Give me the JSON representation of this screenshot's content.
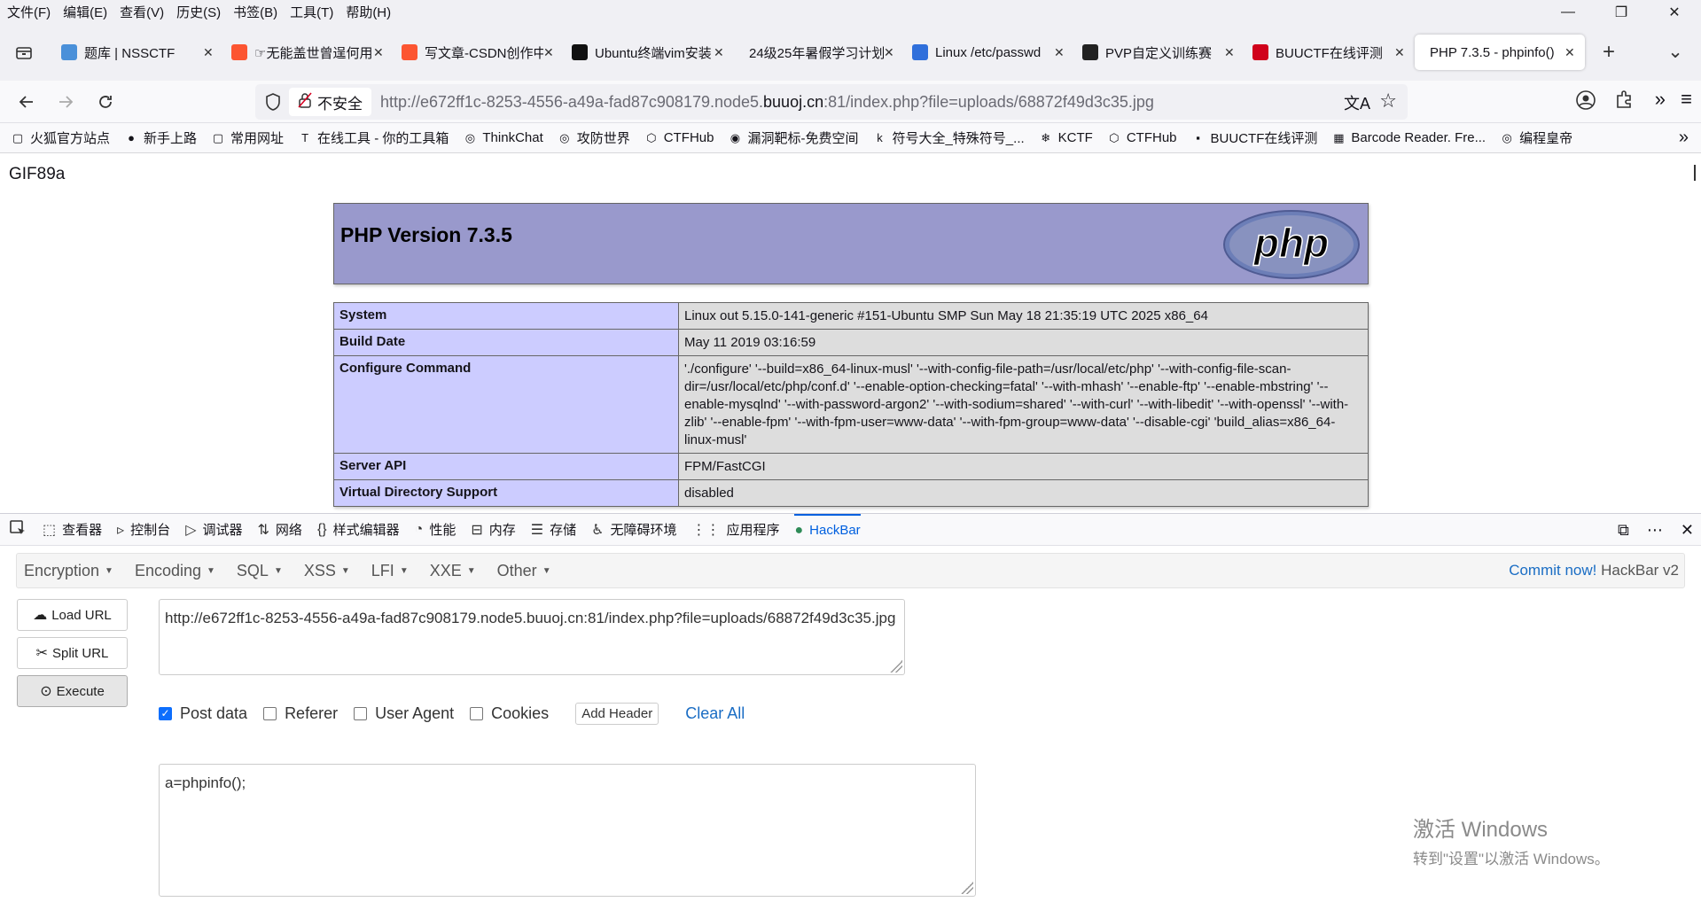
{
  "menubar": {
    "items": [
      "文件(F)",
      "编辑(E)",
      "查看(V)",
      "历史(S)",
      "书签(B)",
      "工具(T)",
      "帮助(H)"
    ]
  },
  "window": {
    "minimize": "—",
    "restore": "❐",
    "close": "✕"
  },
  "tabs": [
    {
      "label": "题库 | NSSCTF",
      "icon_color": "#4a90d9"
    },
    {
      "label": "☞无能盖世曾逞何用",
      "icon_color": "#fc5531"
    },
    {
      "label": "写文章-CSDN创作中心",
      "icon_color": "#fc5531"
    },
    {
      "label": "Ubuntu终端vim安装",
      "icon_color": "#111111"
    },
    {
      "label": "24级25年暑假学习计划",
      "icon_color": "#ffffff"
    },
    {
      "label": "Linux /etc/passwd",
      "icon_color": "#2f6fdb"
    },
    {
      "label": "PVP自定义训练赛",
      "icon_color": "#222222"
    },
    {
      "label": "BUUCTF在线评测",
      "icon_color": "#d0021b"
    },
    {
      "label": "PHP 7.3.5 - phpinfo()",
      "icon_color": "#ffffff",
      "active": true
    }
  ],
  "tab_close": "✕",
  "new_tab": "+",
  "tab_list": "⌄",
  "nav": {
    "insecure_label": "不安全",
    "url_prefix": "http://e672ff1c-8253-4556-a49a-fad87c908179.node5.",
    "url_domain": "buuoj.cn",
    "url_suffix": ":81/index.php?file=uploads/68872f49d3c35.jpg"
  },
  "bookmarks": [
    {
      "label": "火狐官方站点",
      "icon": "▢"
    },
    {
      "label": "新手上路",
      "icon": "●"
    },
    {
      "label": "常用网址",
      "icon": "▢"
    },
    {
      "label": "在线工具 - 你的工具箱",
      "icon": "T"
    },
    {
      "label": "ThinkChat",
      "icon": "◎"
    },
    {
      "label": "攻防世界",
      "icon": "◎"
    },
    {
      "label": "CTFHub",
      "icon": "⬡"
    },
    {
      "label": "漏洞靶标-免费空间",
      "icon": "◉"
    },
    {
      "label": "符号大全_特殊符号_...",
      "icon": "k"
    },
    {
      "label": "KCTF",
      "icon": "❄"
    },
    {
      "label": "CTFHub",
      "icon": "⬡"
    },
    {
      "label": "BUUCTF在线评测",
      "icon": "▪"
    },
    {
      "label": "Barcode Reader. Fre...",
      "icon": "▦"
    },
    {
      "label": "编程皇帝",
      "icon": "◎"
    }
  ],
  "page": {
    "gif_header": "GIF89a",
    "php_title": "PHP Version 7.3.5",
    "php_logo_text": "php",
    "rows": [
      {
        "key": "System",
        "value": "Linux out 5.15.0-141-generic #151-Ubuntu SMP Sun May 18 21:35:19 UTC 2025 x86_64"
      },
      {
        "key": "Build Date",
        "value": "May 11 2019 03:16:59"
      },
      {
        "key": "Configure Command",
        "value": "'./configure' '--build=x86_64-linux-musl' '--with-config-file-path=/usr/local/etc/php' '--with-config-file-scan-dir=/usr/local/etc/php/conf.d' '--enable-option-checking=fatal' '--with-mhash' '--enable-ftp' '--enable-mbstring' '--enable-mysqlnd' '--with-password-argon2' '--with-sodium=shared' '--with-curl' '--with-libedit' '--with-openssl' '--with-zlib' '--enable-fpm' '--with-fpm-user=www-data' '--with-fpm-group=www-data' '--disable-cgi' 'build_alias=x86_64-linux-musl'"
      },
      {
        "key": "Server API",
        "value": "FPM/FastCGI"
      },
      {
        "key": "Virtual Directory Support",
        "value": "disabled"
      }
    ]
  },
  "devtools": {
    "tabs": [
      {
        "label": "查看器",
        "icon": "⬚"
      },
      {
        "label": "控制台",
        "icon": "▹"
      },
      {
        "label": "调试器",
        "icon": "▷"
      },
      {
        "label": "网络",
        "icon": "⇅"
      },
      {
        "label": "样式编辑器",
        "icon": "{}"
      },
      {
        "label": "性能",
        "icon": "◔"
      },
      {
        "label": "内存",
        "icon": "⊟"
      },
      {
        "label": "存储",
        "icon": "☰"
      },
      {
        "label": "无障碍环境",
        "icon": "♿"
      },
      {
        "label": "应用程序",
        "icon": "⋮⋮"
      },
      {
        "label": "HackBar",
        "icon": "●",
        "active": true
      }
    ],
    "right": [
      "⧉",
      "⋯",
      "✕"
    ]
  },
  "hackbar": {
    "menus": [
      "Encryption",
      "Encoding",
      "SQL",
      "XSS",
      "LFI",
      "XXE",
      "Other"
    ],
    "commit_link": "Commit now!",
    "version": "HackBar v2",
    "load_url": "Load URL",
    "split_url": "Split URL",
    "execute": "Execute",
    "url_value": "http://e672ff1c-8253-4556-a49a-fad87c908179.node5.buuoj.cn:81/index.php?file=uploads/68872f49d3c35.jpg",
    "options": [
      {
        "label": "Post data",
        "checked": true
      },
      {
        "label": "Referer",
        "checked": false
      },
      {
        "label": "User Agent",
        "checked": false
      },
      {
        "label": "Cookies",
        "checked": false
      }
    ],
    "add_header": "Add Header",
    "clear_all": "Clear All",
    "post_value": "a=phpinfo();"
  },
  "watermark": {
    "line1": "激活 Windows",
    "line2": "转到\"设置\"以激活 Windows。"
  }
}
